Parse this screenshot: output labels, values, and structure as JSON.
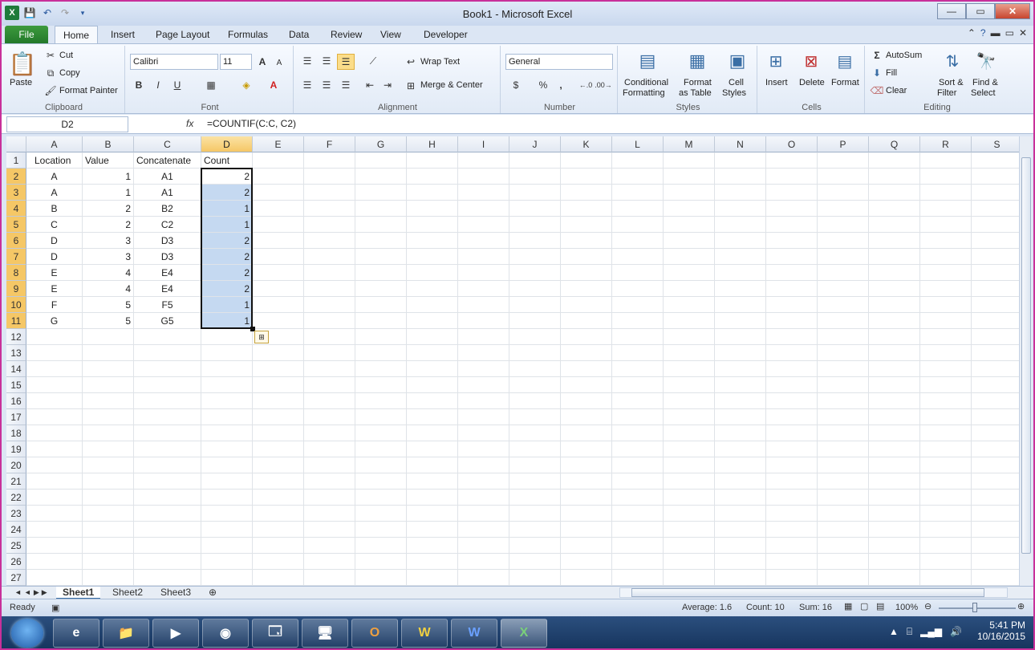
{
  "window": {
    "title": "Book1  -  Microsoft Excel",
    "logo": "X",
    "min": "—",
    "max": "▭",
    "close": "✕"
  },
  "tabs": [
    "File",
    "Home",
    "Insert",
    "Page Layout",
    "Formulas",
    "Data",
    "Review",
    "View",
    "Developer"
  ],
  "ribbon": {
    "clipboard": {
      "label": "Clipboard",
      "paste": "Paste",
      "cut": "Cut",
      "copy": "Copy",
      "format_painter": "Format Painter"
    },
    "font": {
      "label": "Font",
      "family": "Calibri",
      "size": "11",
      "bold": "B",
      "italic": "I",
      "underline": "U",
      "grow": "A",
      "shrink": "A"
    },
    "alignment": {
      "label": "Alignment",
      "wrap": "Wrap Text",
      "merge": "Merge & Center"
    },
    "number": {
      "label": "Number",
      "format": "General",
      "currency": "$",
      "percent": "%",
      "comma": ","
    },
    "styles": {
      "label": "Styles",
      "conditional": "Conditional",
      "conditional2": "Formatting",
      "table": "Format",
      "table2": "as Table",
      "cell": "Cell",
      "cell2": "Styles"
    },
    "cells": {
      "label": "Cells",
      "insert": "Insert",
      "delete": "Delete",
      "format": "Format"
    },
    "editing": {
      "label": "Editing",
      "autosum": "AutoSum",
      "fill": "Fill",
      "clear": "Clear",
      "sort": "Sort &",
      "sort2": "Filter",
      "find": "Find &",
      "find2": "Select"
    }
  },
  "formula_bar": {
    "name_box": "D2",
    "fx": "fx",
    "formula": "=COUNTIF(C:C, C2)"
  },
  "columns": [
    "A",
    "B",
    "C",
    "D",
    "E",
    "F",
    "G",
    "H",
    "I",
    "J",
    "K",
    "L",
    "M",
    "N",
    "O",
    "P",
    "Q",
    "R",
    "S"
  ],
  "rows": [
    "1",
    "2",
    "3",
    "4",
    "5",
    "6",
    "7",
    "8",
    "9",
    "10",
    "11",
    "12",
    "13",
    "14",
    "15",
    "16",
    "17",
    "18",
    "19",
    "20",
    "21",
    "22",
    "23",
    "24",
    "25",
    "26",
    "27"
  ],
  "headers": [
    "Location",
    "Value",
    "Concatenate",
    "Count"
  ],
  "data": [
    [
      "A",
      "1",
      "A1",
      "2"
    ],
    [
      "A",
      "1",
      "A1",
      "2"
    ],
    [
      "B",
      "2",
      "B2",
      "1"
    ],
    [
      "C",
      "2",
      "C2",
      "1"
    ],
    [
      "D",
      "3",
      "D3",
      "2"
    ],
    [
      "D",
      "3",
      "D3",
      "2"
    ],
    [
      "E",
      "4",
      "E4",
      "2"
    ],
    [
      "E",
      "4",
      "E4",
      "2"
    ],
    [
      "F",
      "5",
      "F5",
      "1"
    ],
    [
      "G",
      "5",
      "G5",
      "1"
    ]
  ],
  "sheets": [
    "Sheet1",
    "Sheet2",
    "Sheet3"
  ],
  "status": {
    "ready": "Ready",
    "average": "Average: 1.6",
    "count": "Count: 10",
    "sum": "Sum: 16",
    "zoom": "100%"
  },
  "taskbar": {
    "time": "5:41 PM",
    "date": "10/16/2015",
    "apps": [
      "e",
      "📁",
      "▶",
      "◉",
      "🗔",
      "🖥",
      "O",
      "W",
      "W",
      "X"
    ]
  }
}
